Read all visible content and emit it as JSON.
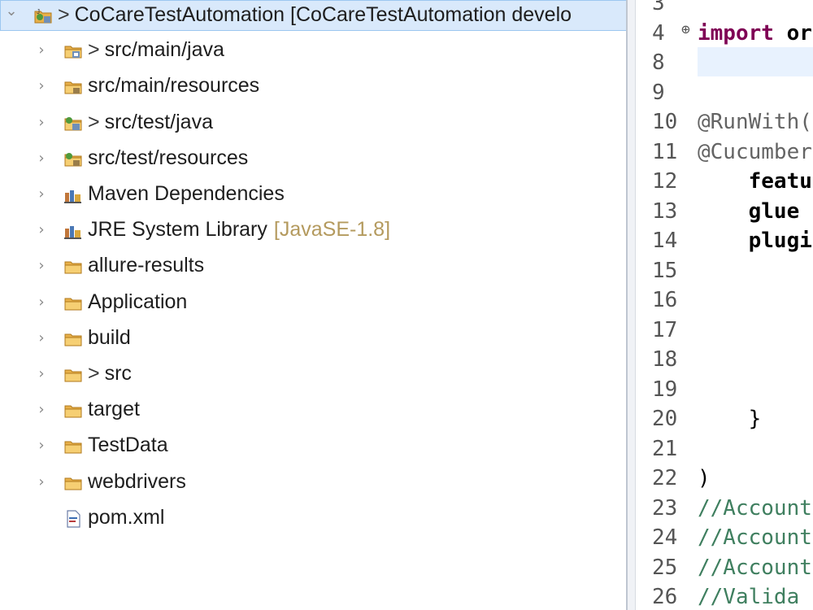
{
  "explorer": {
    "project": {
      "git_mark": ">",
      "label": "CoCareTestAutomation [CoCareTestAutomation develo",
      "expanded_twisty": "⌄"
    },
    "items": [
      {
        "label": "src/main/java",
        "git_mark": ">",
        "icon": "java-source-folder-icon",
        "decorator": ""
      },
      {
        "label": "src/main/resources",
        "git_mark": "",
        "icon": "resource-folder-icon",
        "decorator": ""
      },
      {
        "label": "src/test/java",
        "git_mark": ">",
        "icon": "test-source-folder-icon",
        "decorator": ""
      },
      {
        "label": "src/test/resources",
        "git_mark": "",
        "icon": "test-resource-folder-icon",
        "decorator": ""
      },
      {
        "label": "Maven Dependencies",
        "git_mark": "",
        "icon": "library-icon",
        "decorator": ""
      },
      {
        "label": "JRE System Library",
        "git_mark": "",
        "icon": "library-icon",
        "decorator": "[JavaSE-1.8]"
      },
      {
        "label": "allure-results",
        "git_mark": "",
        "icon": "folder-icon",
        "decorator": ""
      },
      {
        "label": "Application",
        "git_mark": "",
        "icon": "folder-icon",
        "decorator": ""
      },
      {
        "label": "build",
        "git_mark": "",
        "icon": "folder-icon",
        "decorator": ""
      },
      {
        "label": "src",
        "git_mark": ">",
        "icon": "folder-icon",
        "decorator": ""
      },
      {
        "label": "target",
        "git_mark": "",
        "icon": "folder-icon",
        "decorator": ""
      },
      {
        "label": "TestData",
        "git_mark": "",
        "icon": "folder-icon",
        "decorator": ""
      },
      {
        "label": "webdrivers",
        "git_mark": "",
        "icon": "folder-icon",
        "decorator": ""
      },
      {
        "label": "pom.xml",
        "git_mark": "",
        "icon": "xml-file-icon",
        "decorator": ""
      }
    ],
    "collapsed_twisty": "›"
  },
  "editor": {
    "lines": [
      {
        "number": "3",
        "fold": "",
        "code": "",
        "kind": "default"
      },
      {
        "number": "4",
        "fold": "⊕",
        "code": "import or",
        "kind": "import"
      },
      {
        "number": "8",
        "fold": "",
        "code": "",
        "kind": "default"
      },
      {
        "number": "9",
        "fold": "",
        "code": "",
        "kind": "default"
      },
      {
        "number": "10",
        "fold": "",
        "code": "@RunWith(",
        "kind": "annotation"
      },
      {
        "number": "11",
        "fold": "",
        "code": "@Cucumber",
        "kind": "annotation"
      },
      {
        "number": "12",
        "fold": "",
        "code": "    featu",
        "kind": "plain"
      },
      {
        "number": "13",
        "fold": "",
        "code": "    glue",
        "kind": "plain"
      },
      {
        "number": "14",
        "fold": "",
        "code": "    plugi",
        "kind": "plain"
      },
      {
        "number": "15",
        "fold": "",
        "code": "",
        "kind": "default"
      },
      {
        "number": "16",
        "fold": "",
        "code": "",
        "kind": "default"
      },
      {
        "number": "17",
        "fold": "",
        "code": "",
        "kind": "default"
      },
      {
        "number": "18",
        "fold": "",
        "code": "",
        "kind": "default"
      },
      {
        "number": "19",
        "fold": "",
        "code": "",
        "kind": "default"
      },
      {
        "number": "20",
        "fold": "",
        "code": "    }",
        "kind": "default"
      },
      {
        "number": "21",
        "fold": "",
        "code": "",
        "kind": "default"
      },
      {
        "number": "22",
        "fold": "",
        "code": ")",
        "kind": "default"
      },
      {
        "number": "23",
        "fold": "",
        "code": "//Account",
        "kind": "comment"
      },
      {
        "number": "24",
        "fold": "",
        "code": "//Account",
        "kind": "comment"
      },
      {
        "number": "25",
        "fold": "",
        "code": "//Account",
        "kind": "comment"
      },
      {
        "number": "26",
        "fold": "",
        "code": "//Valida",
        "kind": "comment"
      }
    ]
  },
  "colors": {
    "selection": "#d9e9fb",
    "keyword": "#7f0055",
    "comment": "#3f7f5f",
    "annotation": "#646464",
    "decorator": "#b49a5e",
    "folder": "#e8b04a"
  }
}
